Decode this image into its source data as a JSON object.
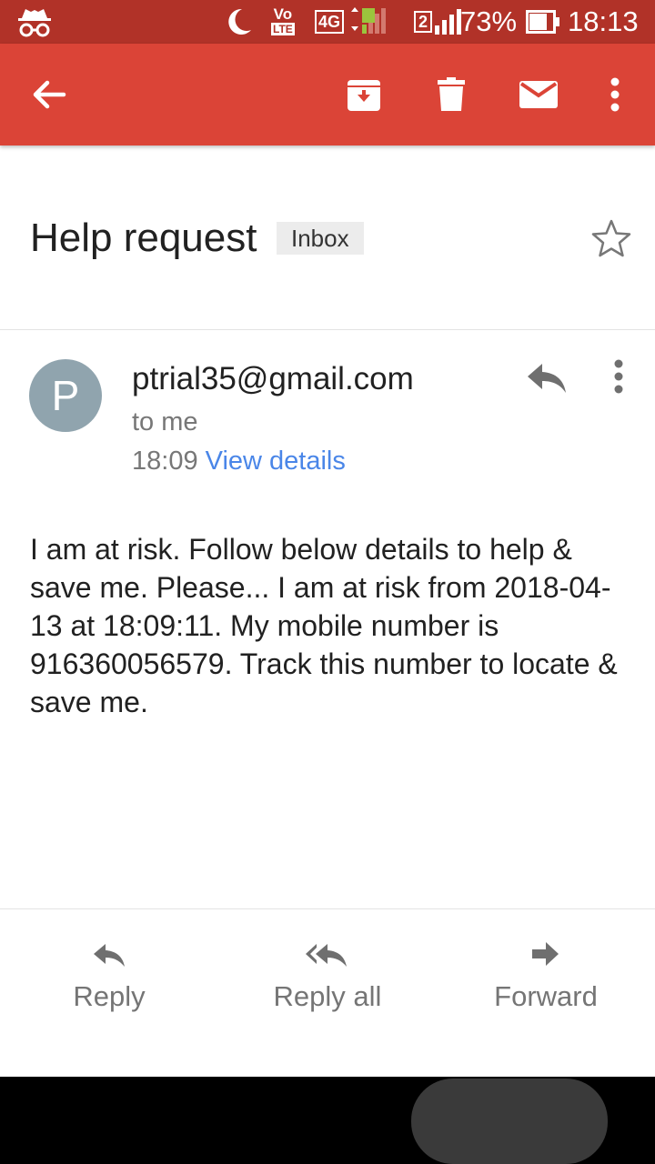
{
  "status_bar": {
    "icons": [
      "incognito-icon",
      "moon-icon",
      "volte-icon",
      "4g-signal-icon",
      "sim2-signal-icon",
      "battery-icon"
    ],
    "volte_top": "Vo",
    "volte_bottom": "LTE",
    "network": "4G",
    "sim_slot": "2",
    "battery": "73%",
    "time": "18:13"
  },
  "toolbar": {
    "icons": [
      "back-arrow-icon",
      "archive-icon",
      "delete-icon",
      "mark-unread-icon",
      "more-vert-icon"
    ]
  },
  "email": {
    "subject": "Help request",
    "label": "Inbox",
    "sender_initial": "P",
    "sender": "ptrial35@gmail.com",
    "recipient": "to me",
    "time": "18:09",
    "view_details": "View details",
    "body": "I am at risk. Follow below details to help & save me. Please... I am at risk from 2018-04-13 at 18:09:11. My mobile number is 916360056579. Track this number to locate & save me."
  },
  "actions": {
    "reply": "Reply",
    "reply_all": "Reply all",
    "forward": "Forward"
  },
  "nav_bar": {
    "icons": [
      "back-icon",
      "home-icon",
      "recent-apps-icon"
    ]
  },
  "colors": {
    "status_bar": "#b13228",
    "app_bar": "#db4437",
    "avatar": "#90a4ae",
    "link": "#4a86e8"
  }
}
